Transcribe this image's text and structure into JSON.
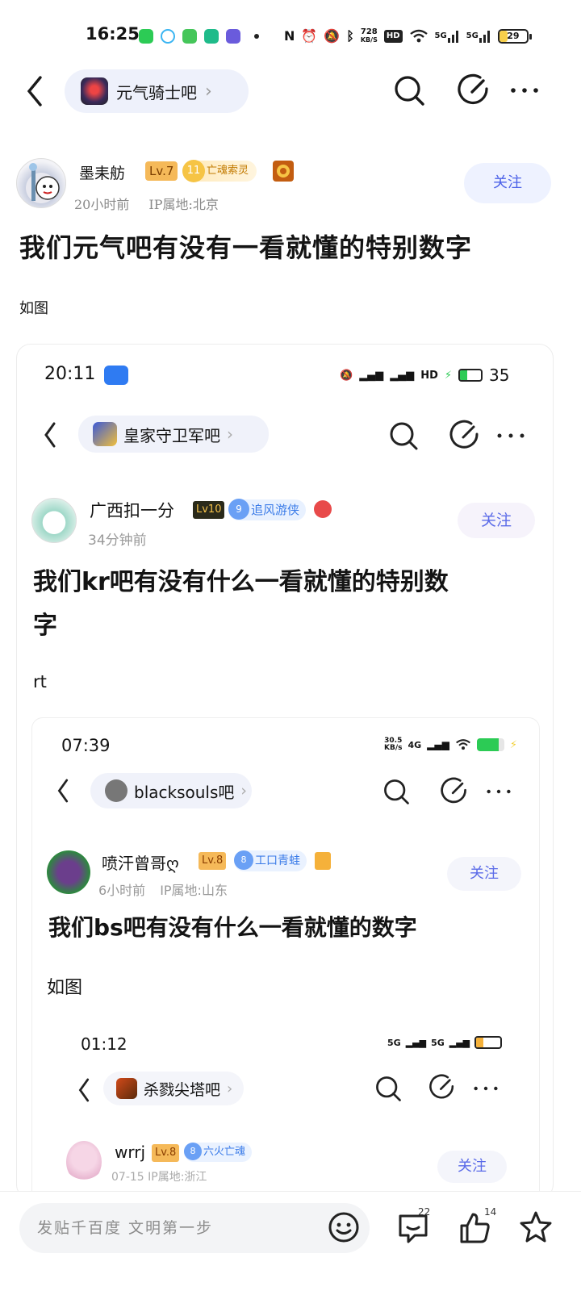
{
  "status_bar": {
    "time": "16:25",
    "net_speed_top": "728",
    "net_speed_unit": "KB/S",
    "hd": "HD",
    "signal1": "5G",
    "signal2": "5G",
    "battery": "29"
  },
  "nav": {
    "forum_name": "元气骑士吧",
    "chevron": "›"
  },
  "post": {
    "author": "墨耒舫",
    "level": "Lv.7",
    "badge_level": "11",
    "badge_name": "亡魂索灵",
    "time_ago": "20小时前",
    "ip": "IP属地:北京",
    "follow_label": "关注",
    "title": "我们元气吧有没有一看就懂的特别数字",
    "body": "如图"
  },
  "shot1": {
    "time": "20:11",
    "battery": "35",
    "hd": "HD",
    "forum_name": "皇家守卫军吧",
    "author": "广西扣一分",
    "level": "Lv10",
    "badge_level": "9",
    "badge_name": "追风游侠",
    "time_ago": "34分钟前",
    "follow_label": "关注",
    "title_line1": "我们kr吧有没有什么一看就懂的特别数",
    "title_line2": "字",
    "body": "rt"
  },
  "shot2": {
    "time": "07:39",
    "net_speed": "30.5",
    "net_unit": "KB/s",
    "signal": "4G",
    "forum_name": "blacksouls吧",
    "author": "喷汗曾哥ღ",
    "level": "Lv.8",
    "badge_level": "8",
    "badge_name": "工口青蛙",
    "time_ago": "6小时前",
    "ip": "IP属地:山东",
    "follow_label": "关注",
    "title": "我们bs吧有没有什么一看就懂的数字",
    "body": "如图"
  },
  "shot3": {
    "time": "01:12",
    "signal1": "5G",
    "signal2": "5G",
    "forum_name": "杀戮尖塔吧",
    "author": "wrrj",
    "level": "Lv.8",
    "badge_level": "8",
    "badge_name": "六火亡魂",
    "meta_partial": "07-15    IP属地:浙江",
    "follow_label": "关注"
  },
  "bottom_bar": {
    "placeholder": "发贴千百度 文明第一步",
    "comments_count": "22",
    "likes_count": "14"
  },
  "colors": {
    "accent": "#4c62e8",
    "level_badge": "#f5b959",
    "follow_bg": "#eef2ff",
    "battery": "#f7cf4b"
  }
}
